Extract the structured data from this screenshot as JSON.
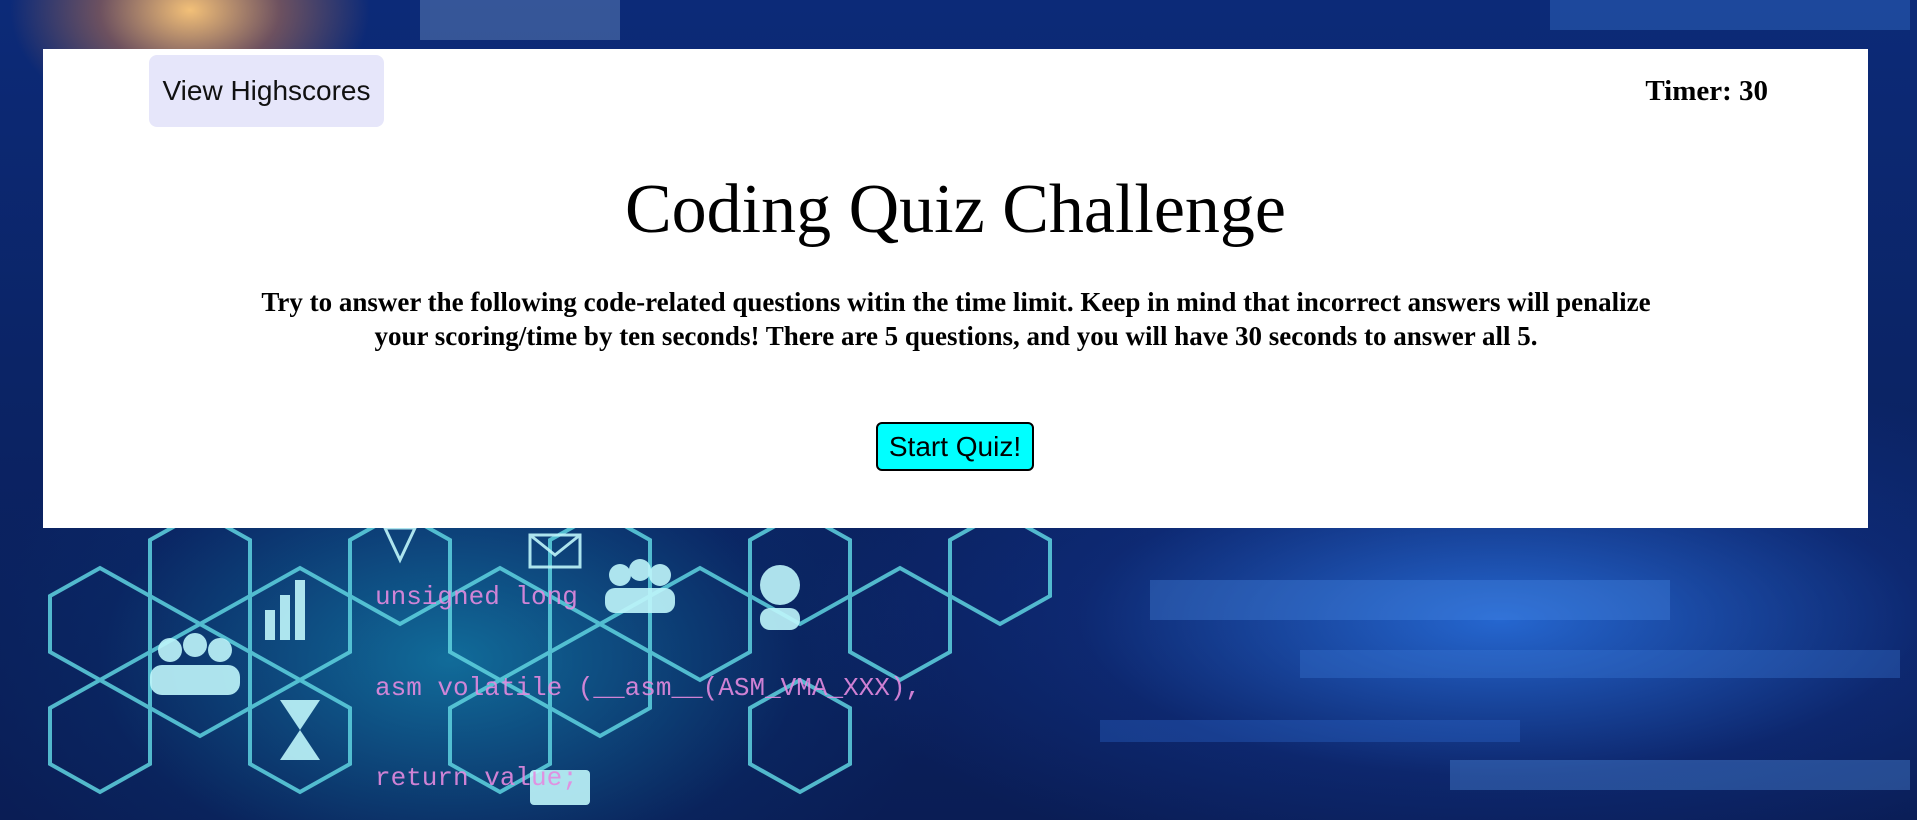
{
  "header": {
    "highscores_label": "View Highscores",
    "timer_label": "Timer:",
    "timer_value": "30"
  },
  "main": {
    "title": "Coding Quiz Challenge",
    "intro": "Try to answer the following code-related questions witin the time limit. Keep in mind that incorrect answers will penalize your scoring/time by ten seconds! There are 5 questions, and you will have 30 seconds to answer all 5.",
    "start_label": "Start Quiz!"
  },
  "background": {
    "code_lines": [
      "unsigned long",
      "asm volatile (__asm__(ASM_VMA_XXX),",
      "return value;"
    ]
  },
  "colors": {
    "card": "#ffffff",
    "highscores_button": "#e6e6fa",
    "start_button": "#00ffff",
    "background": "#0a1f5c",
    "hex_lines": "#5fd3e0",
    "code_text": "#e58ae0"
  },
  "icons": [
    "people-icon",
    "person-icon",
    "hourglass-icon",
    "bar-chart-icon",
    "envelope-icon",
    "laptop-icon"
  ]
}
